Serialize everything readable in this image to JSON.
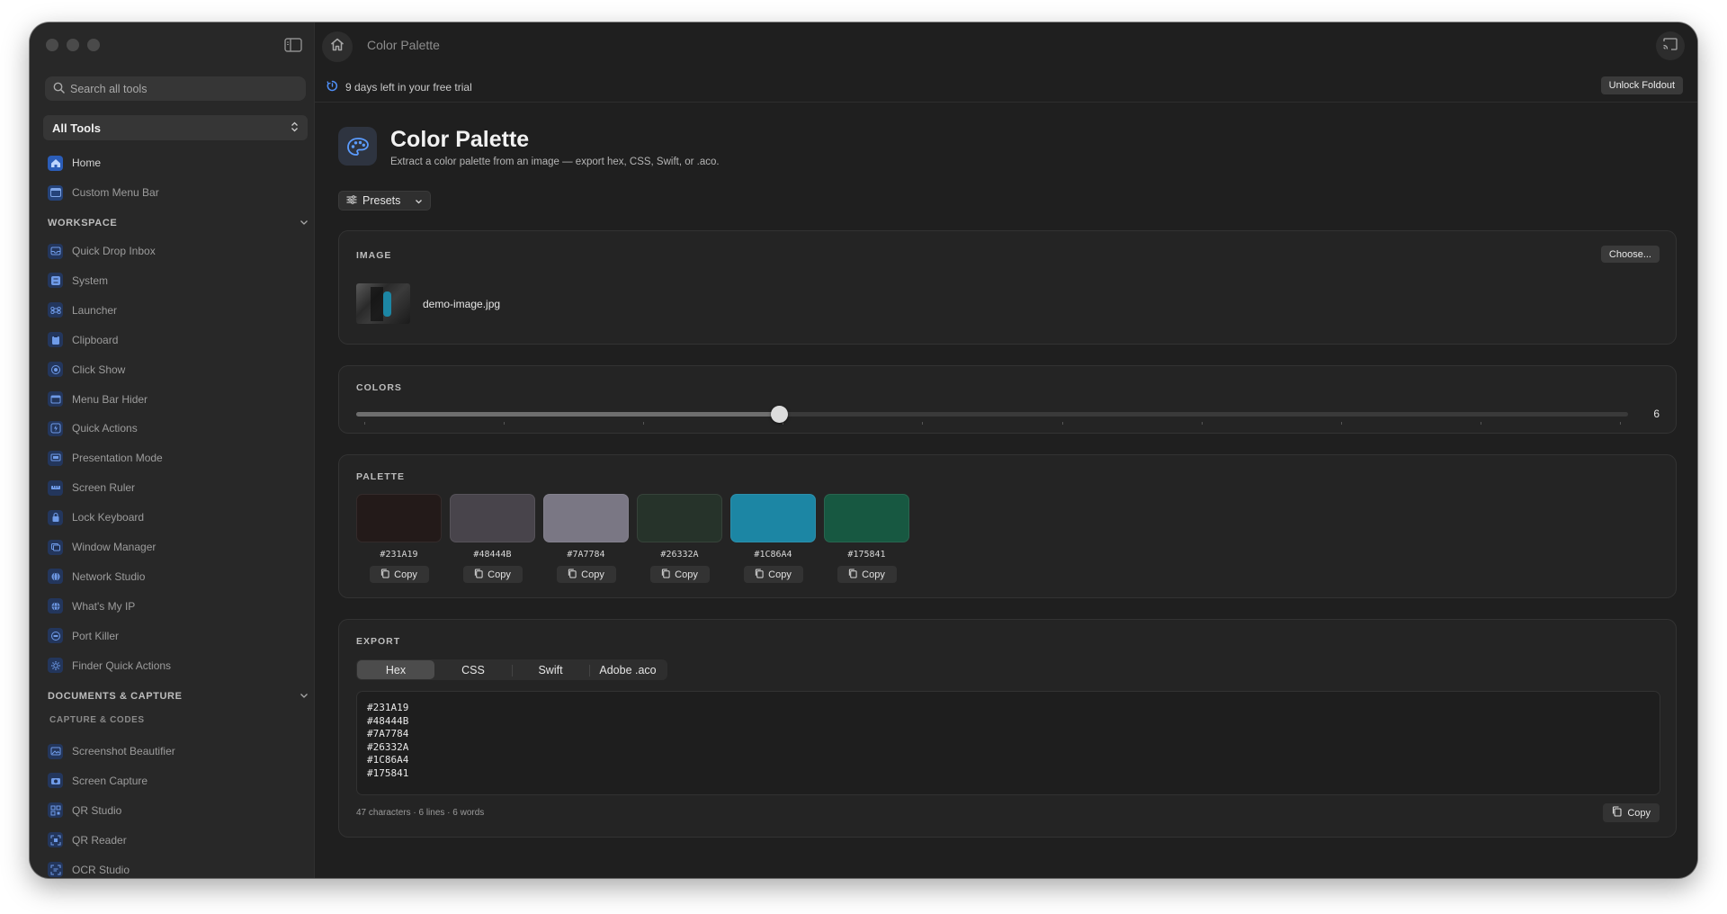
{
  "app": {
    "window_title": "Color Palette"
  },
  "sidebar": {
    "search_placeholder": "Search all tools",
    "tool_select": "All Tools",
    "top_items": [
      {
        "label": "Home",
        "icon": "house-icon"
      },
      {
        "label": "Custom Menu Bar",
        "icon": "menubar-icon"
      }
    ],
    "workspace": {
      "title": "WORKSPACE",
      "items": [
        {
          "label": "Quick Drop Inbox",
          "icon": "inbox-icon"
        },
        {
          "label": "System",
          "icon": "system-icon"
        },
        {
          "label": "Launcher",
          "icon": "command-icon"
        },
        {
          "label": "Clipboard",
          "icon": "clipboard-icon"
        },
        {
          "label": "Click Show",
          "icon": "click-icon"
        },
        {
          "label": "Menu Bar Hider",
          "icon": "menubar-icon"
        },
        {
          "label": "Quick Actions",
          "icon": "bolt-icon"
        },
        {
          "label": "Presentation Mode",
          "icon": "presentation-icon"
        },
        {
          "label": "Screen Ruler",
          "icon": "ruler-icon"
        },
        {
          "label": "Lock Keyboard",
          "icon": "lock-icon"
        },
        {
          "label": "Window Manager",
          "icon": "window-icon"
        },
        {
          "label": "Network Studio",
          "icon": "network-icon"
        },
        {
          "label": "What's My IP",
          "icon": "globe-icon"
        },
        {
          "label": "Port Killer",
          "icon": "port-icon"
        },
        {
          "label": "Finder Quick Actions",
          "icon": "gear-icon"
        }
      ]
    },
    "documents": {
      "title": "DOCUMENTS & CAPTURE",
      "subtitle": "CAPTURE & CODES",
      "items": [
        {
          "label": "Screenshot Beautifier",
          "icon": "image-icon"
        },
        {
          "label": "Screen Capture",
          "icon": "camera-icon"
        },
        {
          "label": "QR Studio",
          "icon": "qr-icon"
        },
        {
          "label": "QR Reader",
          "icon": "qr-scan-icon"
        },
        {
          "label": "OCR Studio",
          "icon": "text-scan-icon"
        }
      ]
    }
  },
  "trial": {
    "text": "9 days left in your free trial",
    "unlock_label": "Unlock Foldout"
  },
  "header": {
    "title": "Color Palette",
    "subtitle": "Extract a color palette from an image — export hex, CSS, Swift, or .aco.",
    "icon": "palette-icon",
    "presets_label": "Presets"
  },
  "image_card": {
    "label": "IMAGE",
    "choose_label": "Choose...",
    "file_name": "demo-image.jpg"
  },
  "colors_card": {
    "label": "COLORS",
    "value": "6",
    "min": 1,
    "max": 10,
    "position_fraction": 0.333
  },
  "palette_card": {
    "label": "PALETTE",
    "copy_label": "Copy",
    "swatches": [
      {
        "hex": "#231A19",
        "color": "#231A19"
      },
      {
        "hex": "#48444B",
        "color": "#48444B"
      },
      {
        "hex": "#7A7784",
        "color": "#7A7784"
      },
      {
        "hex": "#26332A",
        "color": "#26332A"
      },
      {
        "hex": "#1C86A4",
        "color": "#1C86A4"
      },
      {
        "hex": "#175841",
        "color": "#175841"
      }
    ]
  },
  "export_card": {
    "label": "EXPORT",
    "tabs": [
      "Hex",
      "CSS",
      "Swift",
      "Adobe .aco"
    ],
    "active_tab": 0,
    "lines": [
      "#231A19",
      "#48444B",
      "#7A7784",
      "#26332A",
      "#1C86A4",
      "#175841"
    ],
    "stats": "47 characters · 6 lines · 6 words",
    "copy_label": "Copy"
  },
  "colors": {
    "accent": "#3b82f6",
    "background": "#1f1f1f",
    "sidebar": "#282828"
  }
}
